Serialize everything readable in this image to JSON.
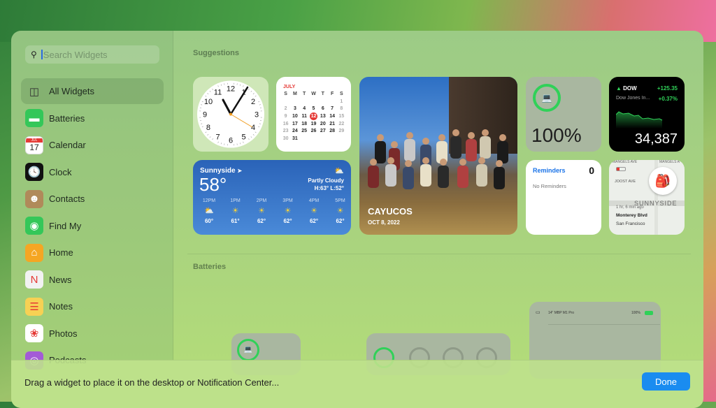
{
  "search": {
    "placeholder": "Search Widgets"
  },
  "sidebar": {
    "items": [
      {
        "label": "All Widgets",
        "icon": "all-widgets-icon",
        "color": "transparent"
      },
      {
        "label": "Batteries",
        "icon": "batteries-icon",
        "color": "#34c759"
      },
      {
        "label": "Calendar",
        "icon": "calendar-icon",
        "color": "#ffffff"
      },
      {
        "label": "Clock",
        "icon": "clock-icon",
        "color": "#111111"
      },
      {
        "label": "Contacts",
        "icon": "contacts-icon",
        "color": "#b08a5a"
      },
      {
        "label": "Find My",
        "icon": "find-my-icon",
        "color": "#34c759"
      },
      {
        "label": "Home",
        "icon": "home-icon",
        "color": "#f5a623"
      },
      {
        "label": "News",
        "icon": "news-icon",
        "color": "#f2f2f2"
      },
      {
        "label": "Notes",
        "icon": "notes-icon",
        "color": "#f7d154"
      },
      {
        "label": "Photos",
        "icon": "photos-icon",
        "color": "#ffffff"
      },
      {
        "label": "Podcasts",
        "icon": "podcasts-icon",
        "color": "#a35bd6"
      }
    ],
    "calendar_icon": {
      "month": "JUL",
      "day": "17"
    }
  },
  "sections": {
    "suggestions": "Suggestions",
    "batteries": "Batteries"
  },
  "clock": {
    "numbers": [
      "12",
      "1",
      "2",
      "3",
      "4",
      "5",
      "6",
      "7",
      "8",
      "9",
      "10",
      "11"
    ]
  },
  "calendar": {
    "month": "JULY",
    "weekdays": [
      "S",
      "M",
      "T",
      "W",
      "T",
      "F",
      "S"
    ],
    "weeks": [
      [
        "",
        "",
        "",
        "",
        "",
        "",
        "1"
      ],
      [
        "2",
        "3",
        "4",
        "5",
        "6",
        "7",
        "8"
      ],
      [
        "9",
        "10",
        "11",
        "12",
        "13",
        "14",
        "15"
      ],
      [
        "16",
        "17",
        "18",
        "19",
        "20",
        "21",
        "22"
      ],
      [
        "23",
        "24",
        "25",
        "26",
        "27",
        "28",
        "29"
      ],
      [
        "30",
        "31",
        "",
        "",
        "",
        "",
        ""
      ]
    ],
    "today": "12"
  },
  "weather": {
    "location": "Sunnyside",
    "temp": "58°",
    "condition": "Partly Cloudy",
    "hilo": "H:63° L:52°",
    "hours": [
      {
        "time": "12PM",
        "icon": "partly-cloudy",
        "temp": "60°"
      },
      {
        "time": "1PM",
        "icon": "sun",
        "temp": "61°"
      },
      {
        "time": "2PM",
        "icon": "sun",
        "temp": "62°"
      },
      {
        "time": "3PM",
        "icon": "sun",
        "temp": "62°"
      },
      {
        "time": "4PM",
        "icon": "sun",
        "temp": "62°"
      },
      {
        "time": "5PM",
        "icon": "sun",
        "temp": "62°"
      }
    ]
  },
  "photo": {
    "title": "CAYUCOS",
    "date": "OCT 8, 2022"
  },
  "battery": {
    "percent": "100%",
    "level": 1.0,
    "color": "#30d158"
  },
  "stocks": {
    "symbol": "DOW",
    "name": "Dow Jones In...",
    "change": "+125.35",
    "pct": "+0.37%",
    "price": "34,387",
    "color": "#30d158"
  },
  "reminders": {
    "title": "Reminders",
    "count": "0",
    "empty": "No Reminders"
  },
  "findmy": {
    "streets": [
      "MANGELS AVE",
      "MANGELS A",
      "JOOST AVE"
    ],
    "area": "SUNNYSIDE",
    "time": "1 hr, 6 min ago",
    "place": "Monterey Blvd",
    "city": "San Francisco"
  },
  "battery_large": {
    "device": "14\" MBP M1 Pro",
    "percent": "100%"
  },
  "footer": {
    "hint": "Drag a widget to place it on the desktop or Notification Center...",
    "done": "Done"
  }
}
